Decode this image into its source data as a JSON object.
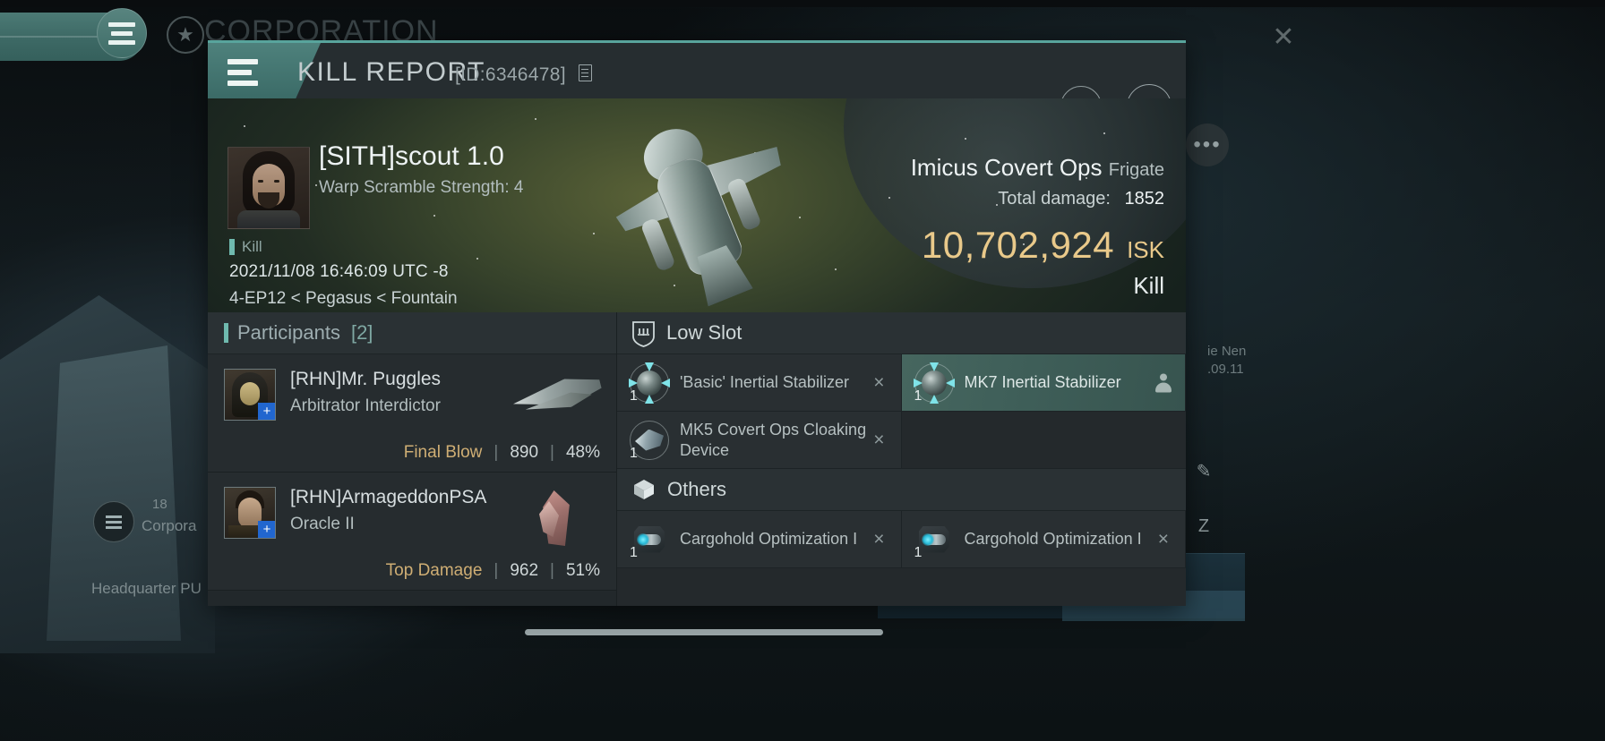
{
  "background": {
    "corporation_label": "CORPORATION",
    "corp_left_label": "Corpora",
    "corp_number": "18",
    "headquarter_label": "Headquarter PU",
    "right_text_1": "ie Nen",
    "right_text_2": ".09.11",
    "menu_icon": "hamburger-icon",
    "star_icon": "star-icon",
    "close_icon": "close-icon",
    "more_icon": "more-dots-icon"
  },
  "window": {
    "title": "KILL REPORT",
    "id_label": "[ID:6346478]",
    "copy_icon": "copy-icon",
    "external_icon": "external-link-icon",
    "close_icon": "close-icon",
    "menu_icon": "hamburger-icon",
    "accent_color": "#58a49c"
  },
  "hero": {
    "victim_name": "[SITH]scout 1.0",
    "victim_subtitle": "Warp Scramble Strength: 4",
    "result_flag": "Kill",
    "timestamp": "2021/11/08 16:46:09 UTC -8",
    "location": "4-EP12 < Pegasus < Fountain",
    "ship_name": "Imicus Covert Ops",
    "ship_class": "Frigate",
    "total_damage_label": "Total damage:",
    "total_damage_value": "1852",
    "isk_value": "10,702,924",
    "isk_unit": "ISK",
    "result_word": "Kill",
    "isk_color": "#e9c98a"
  },
  "participants_section": {
    "title": "Participants",
    "count_label": "[2]",
    "items": [
      {
        "name": "[RHN]Mr. Puggles",
        "ship": "Arbitrator Interdictor",
        "stat_tag": "Final Blow",
        "damage": "890",
        "percent": "48%",
        "badge": "+"
      },
      {
        "name": "[RHN]ArmageddonPSA",
        "ship": "Oracle II",
        "stat_tag": "Top Damage",
        "damage": "962",
        "percent": "51%",
        "badge": "+"
      }
    ]
  },
  "fitting": {
    "sections": [
      {
        "title": "Low Slot",
        "icon": "shield-slot-icon",
        "modules": [
          {
            "name": "'Basic' Inertial Stabilizer",
            "qty": "1",
            "action": "×",
            "selected": false,
            "icon": "inertial-stabilizer-icon"
          },
          {
            "name": "MK7 Inertial Stabilizer",
            "qty": "1",
            "action": "person",
            "selected": true,
            "icon": "inertial-stabilizer-icon"
          },
          {
            "name": "MK5 Covert Ops Cloaking Device",
            "qty": "1",
            "action": "×",
            "selected": false,
            "icon": "cloaking-device-icon"
          }
        ]
      },
      {
        "title": "Others",
        "icon": "cube-icon",
        "modules": [
          {
            "name": "Cargohold Optimization I",
            "qty": "1",
            "action": "×",
            "selected": false,
            "icon": "cargohold-optimization-icon"
          },
          {
            "name": "Cargohold Optimization I",
            "qty": "1",
            "action": "×",
            "selected": false,
            "icon": "cargohold-optimization-icon"
          }
        ]
      }
    ]
  }
}
